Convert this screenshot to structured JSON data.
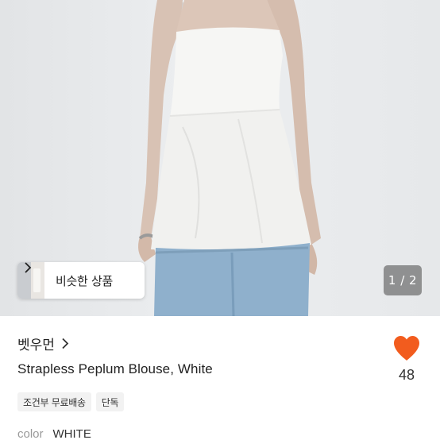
{
  "photo": {
    "alt_subject": "product-photo",
    "similar_button": {
      "label": "비슷한 상품"
    },
    "pager": {
      "text": "1 / 2"
    }
  },
  "shop": {
    "name": "벳우먼"
  },
  "product": {
    "title": "Strapless Peplum Blouse, White",
    "tags": [
      "조건부 무료배송",
      "단독"
    ],
    "color_label": "color",
    "color_value": "WHITE"
  },
  "like": {
    "count": "48",
    "color": "#f25c1e",
    "icon": "heart-icon"
  }
}
